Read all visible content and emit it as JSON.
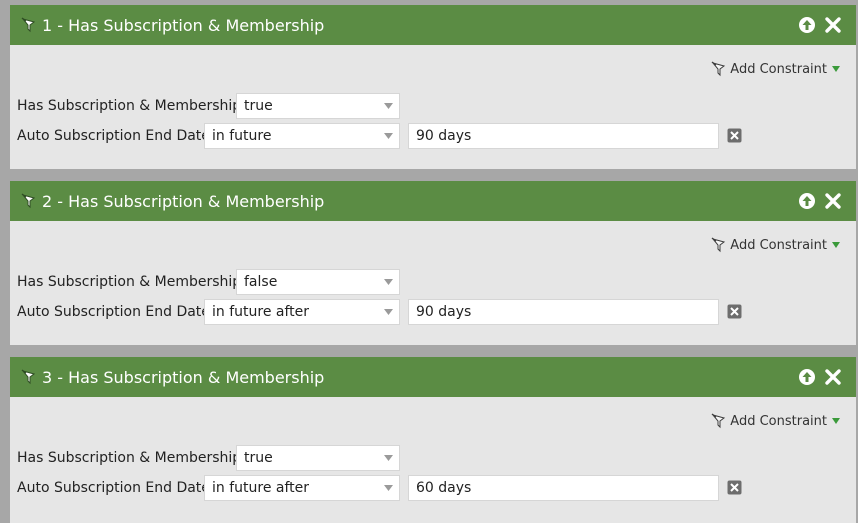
{
  "filters": [
    {
      "title": "1 - Has Subscription & Membership",
      "add_constraint_label": "Add Constraint",
      "row1": {
        "label": "Has Subscription & Membership:",
        "value": "true"
      },
      "row2": {
        "label": "Auto Subscription End Date:",
        "operator": "in future",
        "value": "90 days"
      }
    },
    {
      "title": "2 - Has Subscription & Membership",
      "add_constraint_label": "Add Constraint",
      "row1": {
        "label": "Has Subscription & Membership:",
        "value": "false"
      },
      "row2": {
        "label": "Auto Subscription End Date:",
        "operator": "in future after",
        "value": "90 days"
      }
    },
    {
      "title": "3 - Has Subscription & Membership",
      "add_constraint_label": "Add Constraint",
      "row1": {
        "label": "Has Subscription & Membership:",
        "value": "true"
      },
      "row2": {
        "label": "Auto Subscription End Date:",
        "operator": "in future after",
        "value": "60 days"
      }
    }
  ],
  "icons": {
    "filter": "funnel-icon",
    "move_up": "arrow-up-circle-icon",
    "close": "close-x-icon",
    "add_constraint": "funnel-icon",
    "dropdown": "triangle-down-icon",
    "remove_row": "remove-x-icon"
  },
  "colors": {
    "header_green": "#5b8c44",
    "panel_bg": "#e6e6e6",
    "page_bg": "#a7a7a7",
    "caret_green": "#3a9a3a"
  }
}
